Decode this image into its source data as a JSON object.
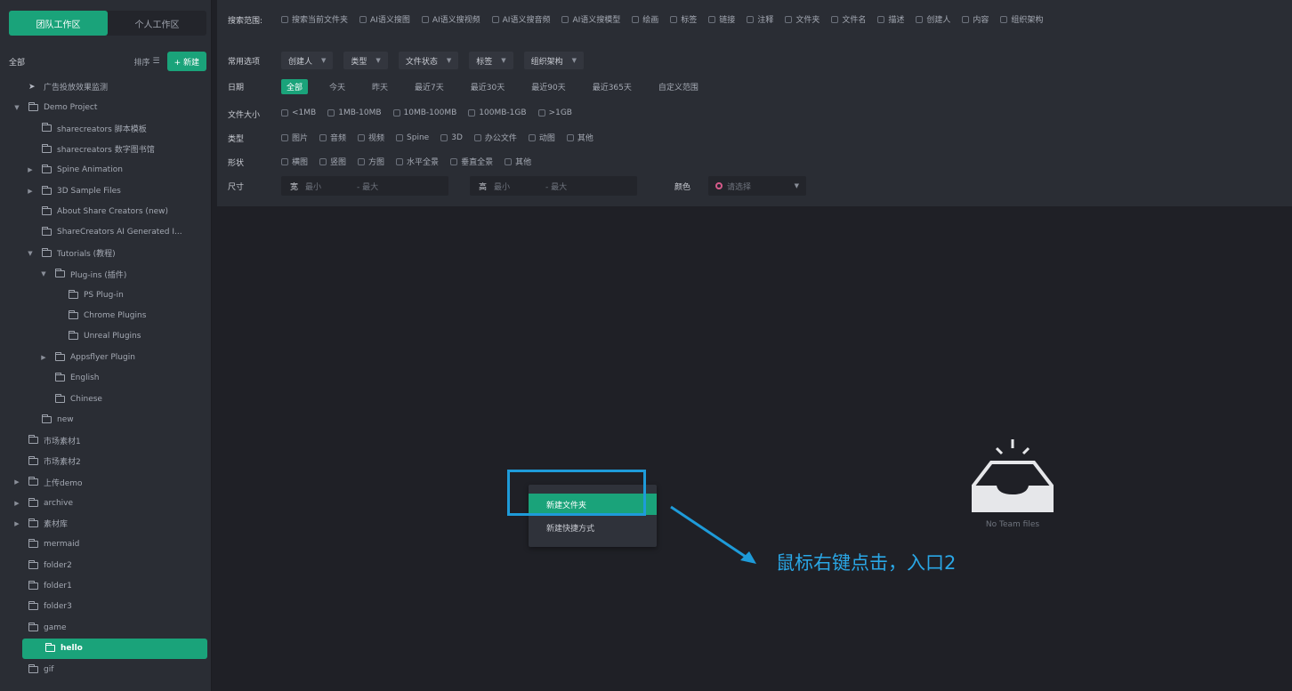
{
  "workspace_tabs": [
    "团队工作区",
    "个人工作区"
  ],
  "sidebar": {
    "all_label": "全部",
    "sort_label": "排序",
    "new_label": "+ 新建",
    "tree": [
      {
        "label": "广告投放效果监测",
        "depth": 0,
        "caret": "",
        "icon": "pin"
      },
      {
        "label": "Demo Project",
        "depth": 0,
        "caret": "▼",
        "icon": "folder"
      },
      {
        "label": "sharecreators 脚本模板",
        "depth": 1,
        "caret": "",
        "icon": "folder"
      },
      {
        "label": "sharecreators 数字图书馆",
        "depth": 1,
        "caret": "",
        "icon": "folder"
      },
      {
        "label": "Spine Animation",
        "depth": 1,
        "caret": "▶",
        "icon": "folder"
      },
      {
        "label": "3D Sample Files",
        "depth": 1,
        "caret": "▶",
        "icon": "folder"
      },
      {
        "label": "About Share Creators (new)",
        "depth": 1,
        "caret": "",
        "icon": "folder"
      },
      {
        "label": "ShareCreators AI Generated I...",
        "depth": 1,
        "caret": "",
        "icon": "folder"
      },
      {
        "label": "Tutorials (教程)",
        "depth": 1,
        "caret": "▼",
        "icon": "folder"
      },
      {
        "label": "Plug-ins (插件)",
        "depth": 2,
        "caret": "▼",
        "icon": "folder"
      },
      {
        "label": "PS Plug-in",
        "depth": 3,
        "caret": "",
        "icon": "folder"
      },
      {
        "label": "Chrome Plugins",
        "depth": 3,
        "caret": "",
        "icon": "folder"
      },
      {
        "label": "Unreal Plugins",
        "depth": 3,
        "caret": "",
        "icon": "folder"
      },
      {
        "label": "Appsflyer Plugin",
        "depth": 2,
        "caret": "▶",
        "icon": "folder"
      },
      {
        "label": "English",
        "depth": 2,
        "caret": "",
        "icon": "folder"
      },
      {
        "label": "Chinese",
        "depth": 2,
        "caret": "",
        "icon": "folder"
      },
      {
        "label": "new",
        "depth": 1,
        "caret": "",
        "icon": "folder"
      },
      {
        "label": "市场素材1",
        "depth": 0,
        "caret": "",
        "icon": "folder"
      },
      {
        "label": "市场素材2",
        "depth": 0,
        "caret": "",
        "icon": "folder"
      },
      {
        "label": "上传demo",
        "depth": 0,
        "caret": "▶",
        "icon": "folder"
      },
      {
        "label": "archive",
        "depth": 0,
        "caret": "▶",
        "icon": "folder"
      },
      {
        "label": "素材库",
        "depth": 0,
        "caret": "▶",
        "icon": "folder"
      },
      {
        "label": "mermaid",
        "depth": 0,
        "caret": "",
        "icon": "folder"
      },
      {
        "label": "folder2",
        "depth": 0,
        "caret": "",
        "icon": "folder"
      },
      {
        "label": "folder1",
        "depth": 0,
        "caret": "",
        "icon": "folder"
      },
      {
        "label": "folder3",
        "depth": 0,
        "caret": "",
        "icon": "folder"
      },
      {
        "label": "game",
        "depth": 0,
        "caret": "",
        "icon": "folder"
      },
      {
        "label": "hello",
        "depth": 0,
        "caret": "",
        "icon": "folder",
        "selected": true
      },
      {
        "label": "gif",
        "depth": 0,
        "caret": "",
        "icon": "folder"
      }
    ]
  },
  "filters": {
    "search_range": {
      "label": "搜索范围:",
      "options": [
        "搜索当前文件夹",
        "AI语义搜图",
        "AI语义搜视频",
        "AI语义搜音频",
        "AI语义搜模型",
        "绘画",
        "标签",
        "链接",
        "注释",
        "文件夹",
        "文件名",
        "描述",
        "创建人",
        "内容",
        "组织架构"
      ]
    },
    "common": {
      "label": "常用选项",
      "dropdowns": [
        "创建人",
        "类型",
        "文件状态",
        "标签",
        "组织架构"
      ]
    },
    "date": {
      "label": "日期",
      "options": [
        "全部",
        "今天",
        "昨天",
        "最近7天",
        "最近30天",
        "最近90天",
        "最近365天",
        "自定义范围"
      ],
      "active": "全部"
    },
    "file_size": {
      "label": "文件大小",
      "options": [
        "<1MB",
        "1MB-10MB",
        "10MB-100MB",
        "100MB-1GB",
        ">1GB"
      ]
    },
    "category": {
      "label": "类型",
      "options": [
        "图片",
        "音频",
        "视频",
        "Spine",
        "3D",
        "办公文件",
        "动图",
        "其他"
      ]
    },
    "shape": {
      "label": "形状",
      "options": [
        "横图",
        "竖图",
        "方图",
        "水平全景",
        "垂直全景",
        "其他"
      ]
    },
    "dimension": {
      "label": "尺寸",
      "width_label": "宽",
      "height_label": "高",
      "min_placeholder": "最小",
      "max_placeholder": "- 最大",
      "color_label": "颜色",
      "color_value": "请选择"
    }
  },
  "context_menu": {
    "items": [
      "新建文件夹",
      "新建快捷方式"
    ],
    "highlighted": "新建文件夹"
  },
  "empty_state": {
    "caption": "No Team files"
  },
  "annotation": {
    "text": "鼠标右键点击，入口2",
    "color": "#2aa7e6"
  },
  "colors": {
    "accent": "#1aa37a",
    "sidebar_bg": "#2a2d34",
    "main_bg": "#1f2026",
    "annotation": "#1e9bd9"
  }
}
